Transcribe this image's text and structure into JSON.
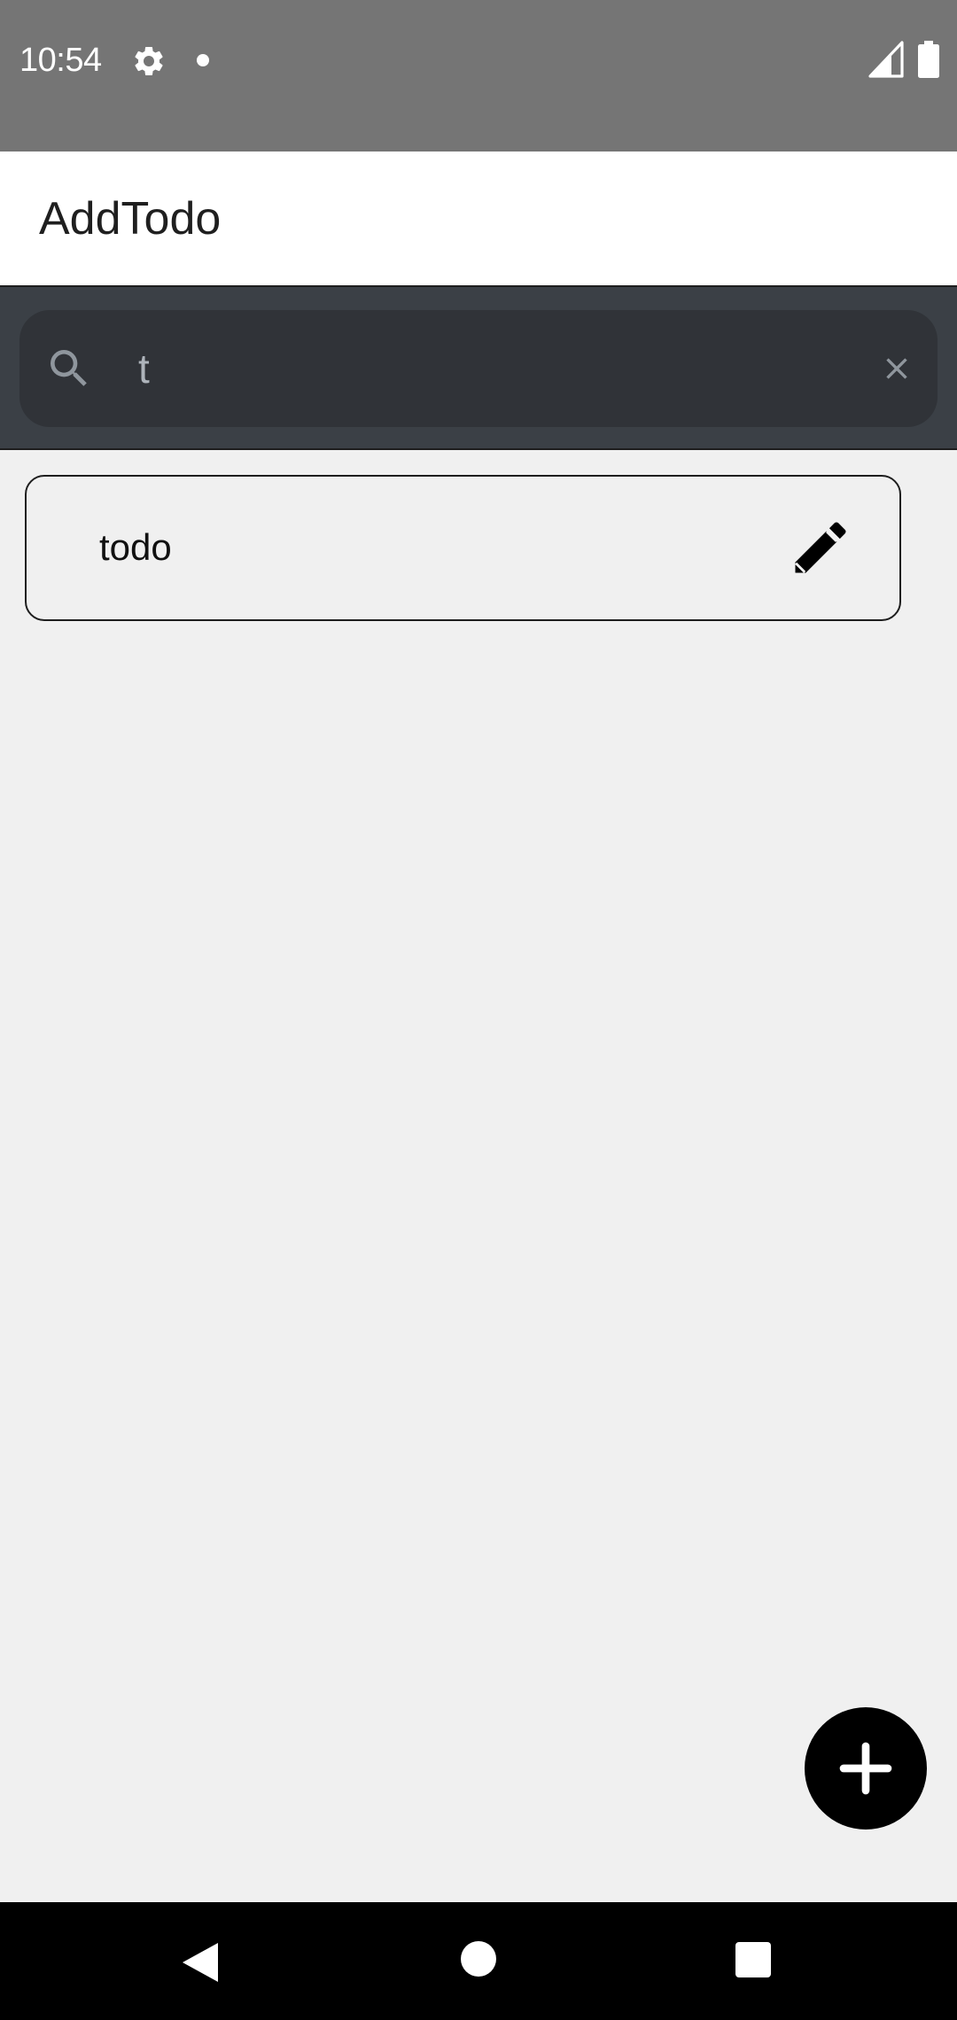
{
  "status_bar": {
    "time": "10:54",
    "icons": [
      "gear-icon",
      "notification-dot-icon",
      "signal-icon",
      "battery-icon"
    ]
  },
  "app_bar": {
    "title": "AddTodo"
  },
  "search": {
    "value": "t",
    "placeholder": "",
    "icon": "search-icon",
    "clear_icon": "close-icon"
  },
  "todos": [
    {
      "label": "todo",
      "action_icon": "pencil-icon"
    }
  ],
  "fab": {
    "icon": "plus-icon"
  },
  "nav_bar": {
    "icons": [
      "back-icon",
      "home-icon",
      "recents-icon"
    ]
  },
  "colors": {
    "status_bar": "#757575",
    "search_strip": "#3b4046",
    "search_box": "#303338",
    "background": "#f0f0f0",
    "fab": "#000000"
  }
}
